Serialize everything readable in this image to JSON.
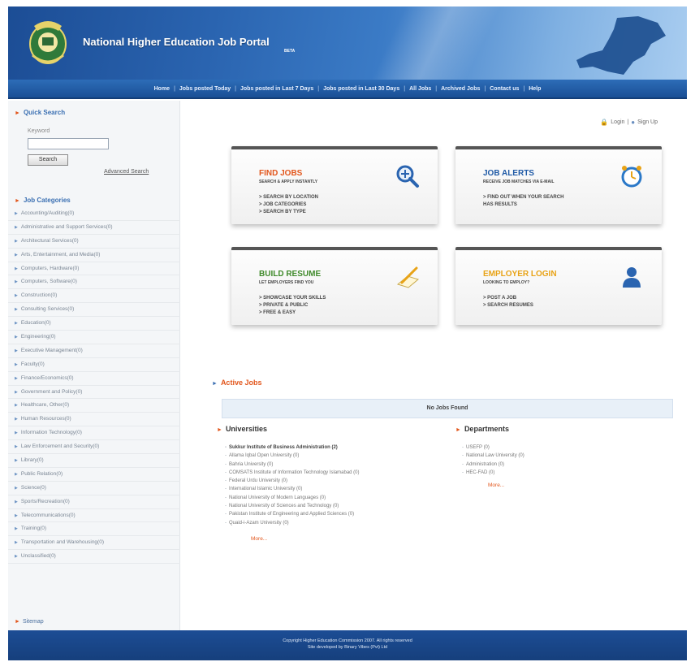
{
  "header": {
    "title": "National Higher Education Job Portal",
    "beta": "BETA"
  },
  "nav": {
    "items": [
      "Home",
      "Jobs posted Today",
      "Jobs posted in Last 7 Days",
      "Jobs posted in Last 30 Days",
      "All Jobs",
      "Archived Jobs",
      "Contact us",
      "Help"
    ],
    "separator": "|"
  },
  "sidebar": {
    "quick_search": "Quick Search",
    "keyword_label": "Keyword",
    "keyword_value": "",
    "search_button": "Search",
    "advanced_search": "Advanced Search",
    "categories_title": "Job Categories",
    "categories": [
      "Accounting/Auditing(0)",
      "Administrative and Support Services(0)",
      "Architectural Services(0)",
      "Arts, Entertainment, and Media(0)",
      "Computers, Hardware(0)",
      "Computers, Software(0)",
      "Construction(0)",
      "Consulting Services(0)",
      "Education(0)",
      "Engineering(0)",
      "Executive Management(0)",
      "Faculty(0)",
      "Finance/Economics(0)",
      "Government and Policy(0)",
      "Healthcare, Other(0)",
      "Human Resources(0)",
      "Information Technology(0)",
      "Law Enforcement and Security(0)",
      "Library(0)",
      "Public Relation(0)",
      "Science(0)",
      "Sports/Recreation(0)",
      "Telecommunications(0)",
      "Training(0)",
      "Transportation and Warehousing(0)",
      "Unclassified(0)"
    ],
    "sitemap": "Sitemap"
  },
  "main": {
    "login": "Login",
    "login_sep": "|",
    "signup": "Sign Up",
    "tiles": {
      "find_jobs": {
        "title": "FIND JOBS",
        "subtitle": "SEARCH & APPLY INSTANTLY",
        "items": [
          "> SEARCH BY LOCATION",
          "> JOB CATEGORIES",
          "> SEARCH BY TYPE"
        ]
      },
      "job_alerts": {
        "title": "JOB ALERTS",
        "subtitle": "RECEIVE JOB MATCHES VIA E-MAIL",
        "items": [
          "> FIND OUT WHEN YOUR SEARCH",
          "HAS RESULTS"
        ]
      },
      "build_resume": {
        "title": "BUILD RESUME",
        "subtitle": "LET EMPLOYERS FIND YOU",
        "items": [
          "> SHOWCASE YOUR SKILLS",
          "> PRIVATE & PUBLIC",
          "> FREE & EASY"
        ]
      },
      "employer_login": {
        "title": "EMPLOYER LOGIN",
        "subtitle": "LOOKING TO EMPLOY?",
        "items": [
          "> POST A JOB",
          "> SEARCH RESUMES"
        ]
      }
    },
    "active_jobs": "Active Jobs",
    "no_jobs": "No Jobs Found",
    "universities": {
      "title": "Universities",
      "items": [
        "Sukkur Institute of Business Administration (2)",
        "Allama Iqbal Open University (0)",
        "Bahria University (0)",
        "COMSATS Institute of Information Technology Islamabad (0)",
        "Federal Urdu University (0)",
        "International Islamic University (0)",
        "National University of Modern Languages (0)",
        "National University of Sciences and Technology (0)",
        "Pakistan Institute of Engineering and Applied Sciences (0)",
        "Quaid-i-Azam University (0)"
      ],
      "more": "More..."
    },
    "departments": {
      "title": "Departments",
      "items": [
        "USEFP (0)",
        "National Law University (0)",
        "Administration (0)",
        "HEC-FAD (0)"
      ],
      "more": "More..."
    }
  },
  "footer": {
    "line1": "Copyright Higher Education Commission 2007. All rights reserved",
    "line2": "Site developed by Binary Vibes (Pvt) Ltd"
  },
  "colors": {
    "header_blue": "#2a64b0",
    "accent_orange": "#e2561c",
    "find_jobs": "#e2561c",
    "job_alerts": "#1f5aa6",
    "build_resume": "#3f8a2a",
    "employer_login": "#e8a317"
  }
}
